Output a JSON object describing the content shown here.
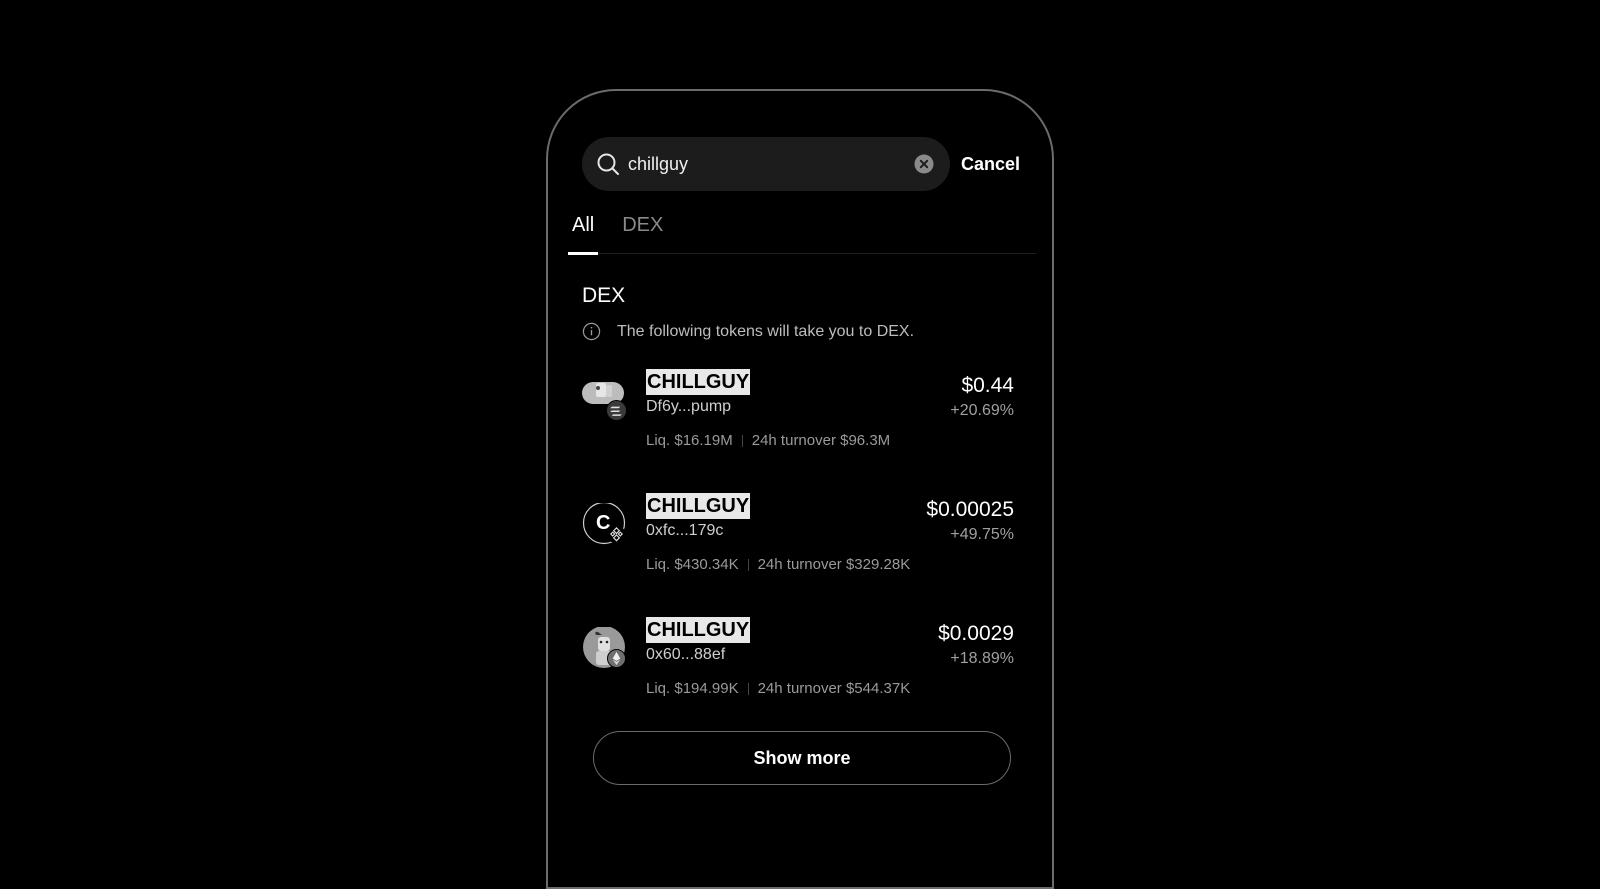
{
  "search": {
    "value": "chillguy",
    "cancel_label": "Cancel"
  },
  "tabs": [
    {
      "label": "All",
      "active": true
    },
    {
      "label": "DEX",
      "active": false
    }
  ],
  "section": {
    "title": "DEX",
    "notice": "The following tokens will take you to DEX."
  },
  "tokens": [
    {
      "name": "CHILLGUY",
      "address": "Df6y...pump",
      "price": "$0.44",
      "change": "+20.69%",
      "liquidity": "Liq. $16.19M",
      "turnover": "24h turnover $96.3M",
      "chain_icon": "solana-icon"
    },
    {
      "name": "CHILLGUY",
      "address": "0xfc...179c",
      "price": "$0.00025",
      "change": "+49.75%",
      "liquidity": "Liq. $430.34K",
      "turnover": "24h turnover $329.28K",
      "avatar_letter": "C",
      "chain_icon": "bnb-icon"
    },
    {
      "name": "CHILLGUY",
      "address": "0x60...88ef",
      "price": "$0.0029",
      "change": "+18.89%",
      "liquidity": "Liq. $194.99K",
      "turnover": "24h turnover $544.37K",
      "chain_icon": "ethereum-icon"
    }
  ],
  "show_more_label": "Show more"
}
